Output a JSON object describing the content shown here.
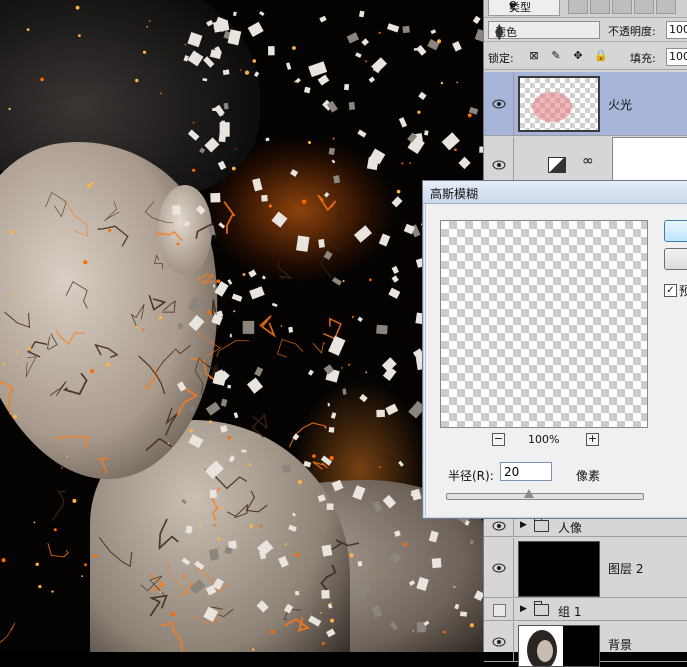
{
  "layers_panel": {
    "filter": {
      "selected": "类型"
    },
    "blend_mode": {
      "selected": "滤色"
    },
    "opacity": {
      "label": "不透明度:",
      "value": "100"
    },
    "lock": {
      "label": "锁定:"
    },
    "fill": {
      "label": "填充:",
      "value": "100"
    },
    "layers": [
      {
        "name": "火光",
        "selected": true,
        "visible": true
      },
      {
        "name": "",
        "type": "adjustment",
        "visible": true
      },
      {
        "name": "人像",
        "type": "group",
        "visible": true
      },
      {
        "name": "图层 2",
        "visible": true
      },
      {
        "name": "组 1",
        "type": "group",
        "visible": false
      },
      {
        "name": "背景",
        "visible": true
      }
    ]
  },
  "dialog": {
    "title": "高斯模糊",
    "zoom": "100%",
    "radius_label": "半径(R):",
    "radius_value": "20",
    "radius_unit": "像素",
    "radius_slider_fraction": 0.42,
    "preview_label": "预",
    "preview_checked": true,
    "ok_label": "",
    "cancel_label": ""
  },
  "icons": [
    "search-icon",
    "eye-icon",
    "lock-transparent-icon",
    "brush-icon",
    "move-icon",
    "lock-icon",
    "chain-link-icon",
    "folder-icon",
    "zoom-out-icon",
    "zoom-in-icon"
  ],
  "colors": {
    "selected_layer": "#a7b6d8",
    "panel_bg": "#d6d6d6",
    "dialog_bg": "#f0f0f0"
  }
}
